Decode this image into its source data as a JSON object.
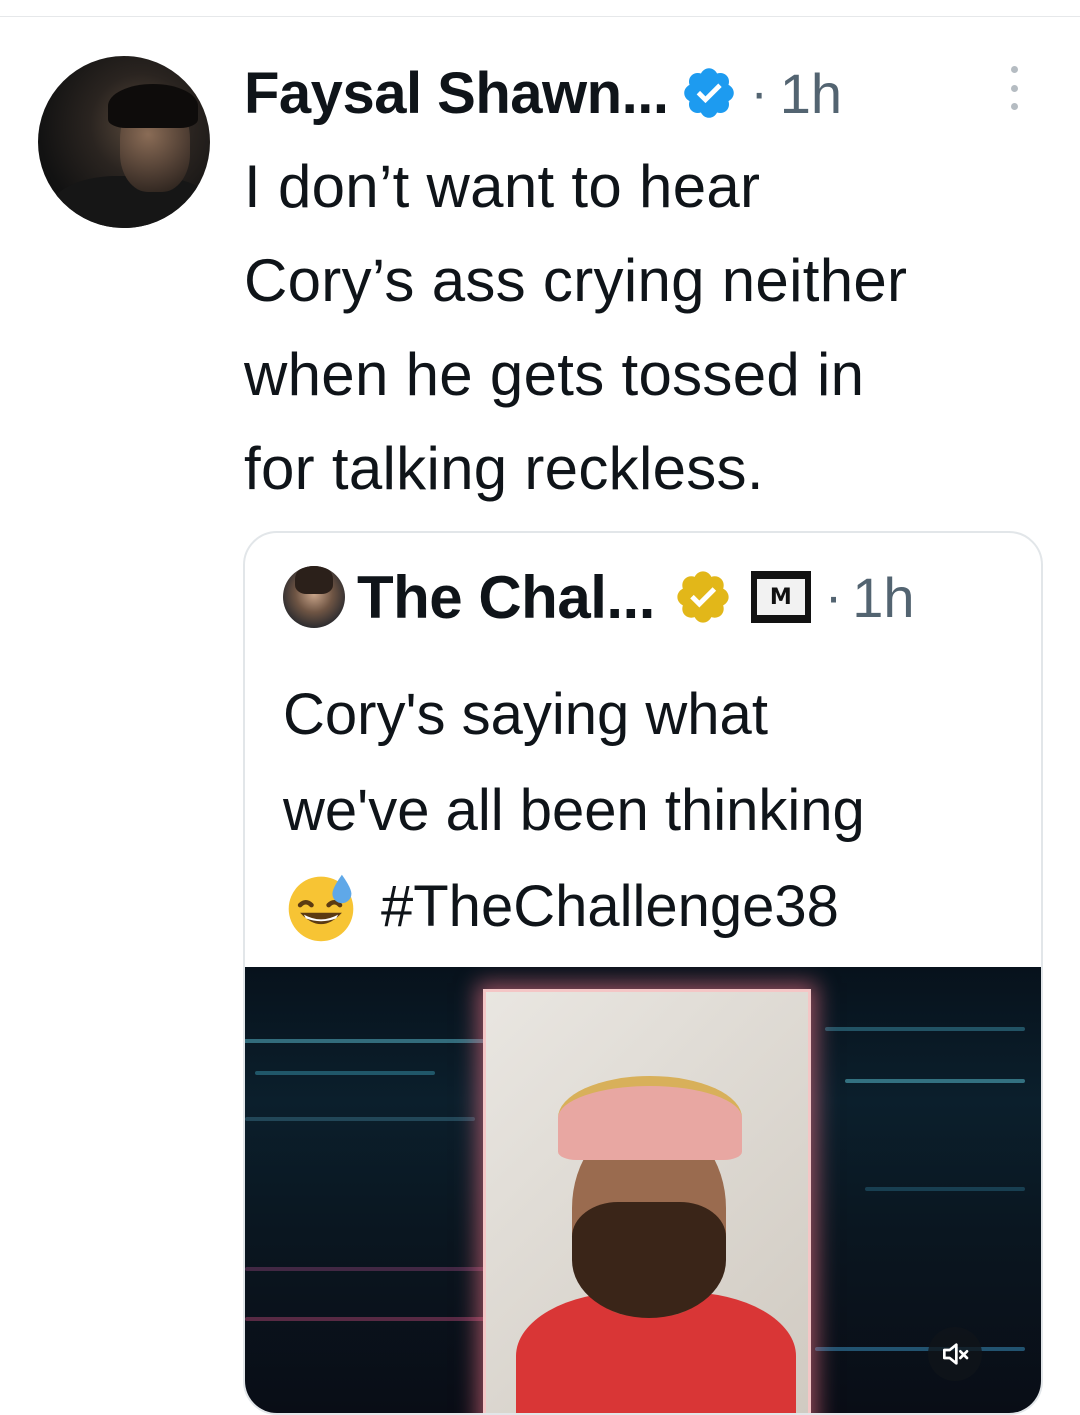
{
  "tweet": {
    "author_name": "Faysal Shawn...",
    "separator": "·",
    "time": "1h",
    "text_lines": [
      "I don’t want to hear",
      "Cory’s ass crying neither",
      "when he gets tossed in",
      "for talking reckless."
    ]
  },
  "quote": {
    "author_name": "The Chal...",
    "separator": "·",
    "time": "1h",
    "text_lines": [
      "Cory's saying what",
      "we've all been thinking"
    ],
    "hashtag": "#TheChallenge38",
    "emoji": "grinning-face-with-sweat"
  },
  "icons": {
    "verified": "blue-verified-badge",
    "org_verified": "gold-verified-badge",
    "affiliate": "mtv-logo",
    "more": "vertical-ellipsis",
    "mute": "speaker-muted"
  },
  "colors": {
    "verified_blue": "#1d9bf0",
    "verified_gold": "#e2b719",
    "muted_text": "#536471"
  }
}
